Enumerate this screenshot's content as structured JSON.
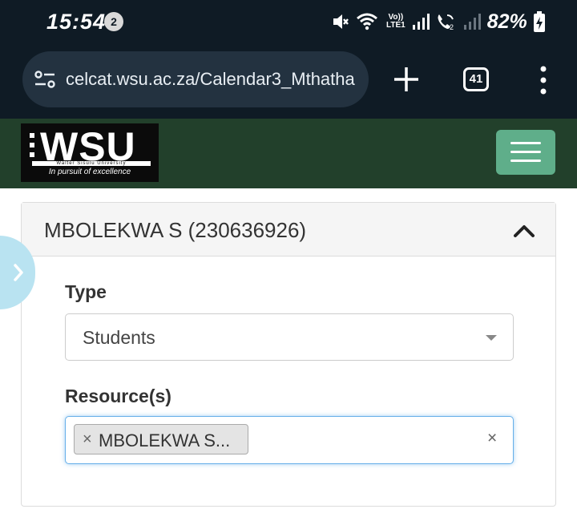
{
  "status_bar": {
    "time": "15:54",
    "notification_count": "2",
    "volte_line1": "Vo))",
    "volte_line2": "LTE1",
    "battery": "82%"
  },
  "browser": {
    "url": "celcat.wsu.ac.za/Calendar3_Mthatha",
    "tab_count": "41"
  },
  "site": {
    "logo_text": "WSU",
    "logo_strip": "Walter Sisulu University",
    "logo_tagline": "In pursuit of excellence",
    "accent_color": "#5fae8a",
    "header_color": "#22402b"
  },
  "panel": {
    "title": "MBOLEKWA S (230636926)",
    "type_label": "Type",
    "type_value": "Students",
    "resource_label": "Resource(s)",
    "resource_chip_remove": "×",
    "resource_chip": "MBOLEKWA S...",
    "clear_all": "×"
  }
}
